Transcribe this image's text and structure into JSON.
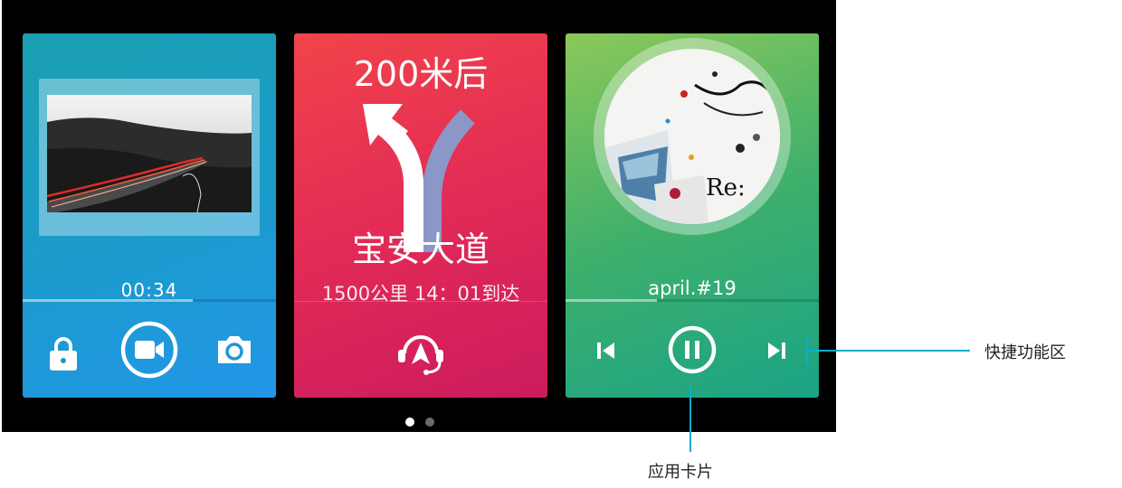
{
  "cards": {
    "camera": {
      "time": "00:34",
      "progress": 0.67,
      "controls": {
        "lock_icon": "lock-icon",
        "record_icon": "video-camera-icon",
        "photo_icon": "camera-icon"
      }
    },
    "navigation": {
      "distance": "200米后",
      "road": "宝安大道",
      "eta": "1500公里 14：01到达",
      "controls": {
        "voice_icon": "navigation-headset-icon"
      }
    },
    "music": {
      "track": "april.#19",
      "progress": 0.36,
      "album_text": "Re:",
      "controls": {
        "prev_icon": "skip-previous-icon",
        "pause_icon": "pause-icon",
        "next_icon": "skip-next-icon"
      }
    }
  },
  "pagination": {
    "current": 1,
    "total": 2
  },
  "annotations": {
    "quick_functions": "快捷功能区",
    "app_card": "应用卡片"
  },
  "colors": {
    "camera_card": "#1b9bcc",
    "nav_card": "#e22b56",
    "music_card": "#3fb06b",
    "annotation_line": "#0aaed0"
  }
}
